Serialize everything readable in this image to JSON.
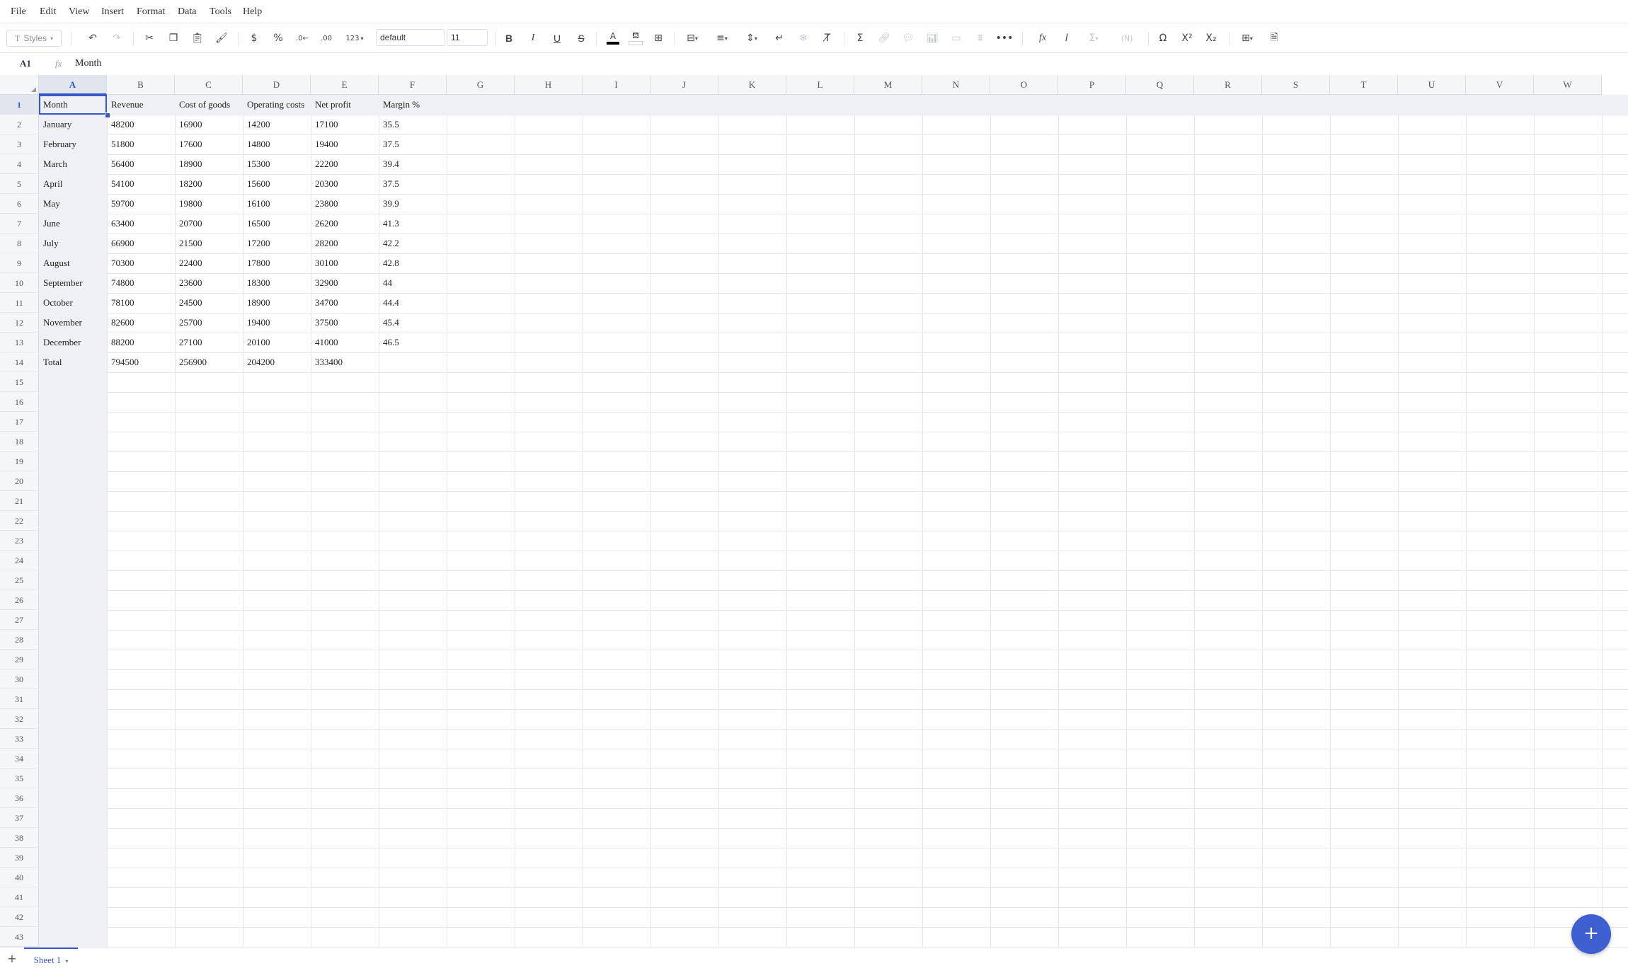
{
  "menu": [
    "File",
    "Edit",
    "View",
    "Insert",
    "Format",
    "Data",
    "Tools",
    "Help"
  ],
  "toolbar": {
    "styles_label": "Styles",
    "font_name": "default",
    "font_size": "11",
    "text_color": "#000000",
    "fill_color": "#ffffff",
    "number_format_label": "123"
  },
  "formula_bar": {
    "cell_ref": "A1",
    "fx_label": "fx",
    "value": "Month"
  },
  "grid": {
    "columns": [
      "A",
      "B",
      "C",
      "D",
      "E",
      "F",
      "G",
      "H",
      "I",
      "J",
      "K",
      "L",
      "M",
      "N",
      "O",
      "P",
      "Q",
      "R",
      "S",
      "T",
      "U",
      "V",
      "W"
    ],
    "row_count": 43,
    "selected_cell": "A1",
    "rows": [
      [
        "Month",
        "Revenue",
        "Cost of goods",
        "Operating costs",
        "Net profit",
        "Margin %"
      ],
      [
        "January",
        "48200",
        "16900",
        "14200",
        "17100",
        "35.5"
      ],
      [
        "February",
        "51800",
        "17600",
        "14800",
        "19400",
        "37.5"
      ],
      [
        "March",
        "56400",
        "18900",
        "15300",
        "22200",
        "39.4"
      ],
      [
        "April",
        "54100",
        "18200",
        "15600",
        "20300",
        "37.5"
      ],
      [
        "May",
        "59700",
        "19800",
        "16100",
        "23800",
        "39.9"
      ],
      [
        "June",
        "63400",
        "20700",
        "16500",
        "26200",
        "41.3"
      ],
      [
        "July",
        "66900",
        "21500",
        "17200",
        "28200",
        "42.2"
      ],
      [
        "August",
        "70300",
        "22400",
        "17800",
        "30100",
        "42.8"
      ],
      [
        "September",
        "74800",
        "23600",
        "18300",
        "32900",
        "44"
      ],
      [
        "October",
        "78100",
        "24500",
        "18900",
        "34700",
        "44.4"
      ],
      [
        "November",
        "82600",
        "25700",
        "19400",
        "37500",
        "45.4"
      ],
      [
        "December",
        "88200",
        "27100",
        "20100",
        "41000",
        "46.5"
      ],
      [
        "Total",
        "794500",
        "256900",
        "204200",
        "333400",
        ""
      ]
    ]
  },
  "sheets": [
    {
      "name": "Sheet 1",
      "active": true
    }
  ],
  "colors": {
    "accent": "#3659c7",
    "fab": "#3d5fcf"
  }
}
